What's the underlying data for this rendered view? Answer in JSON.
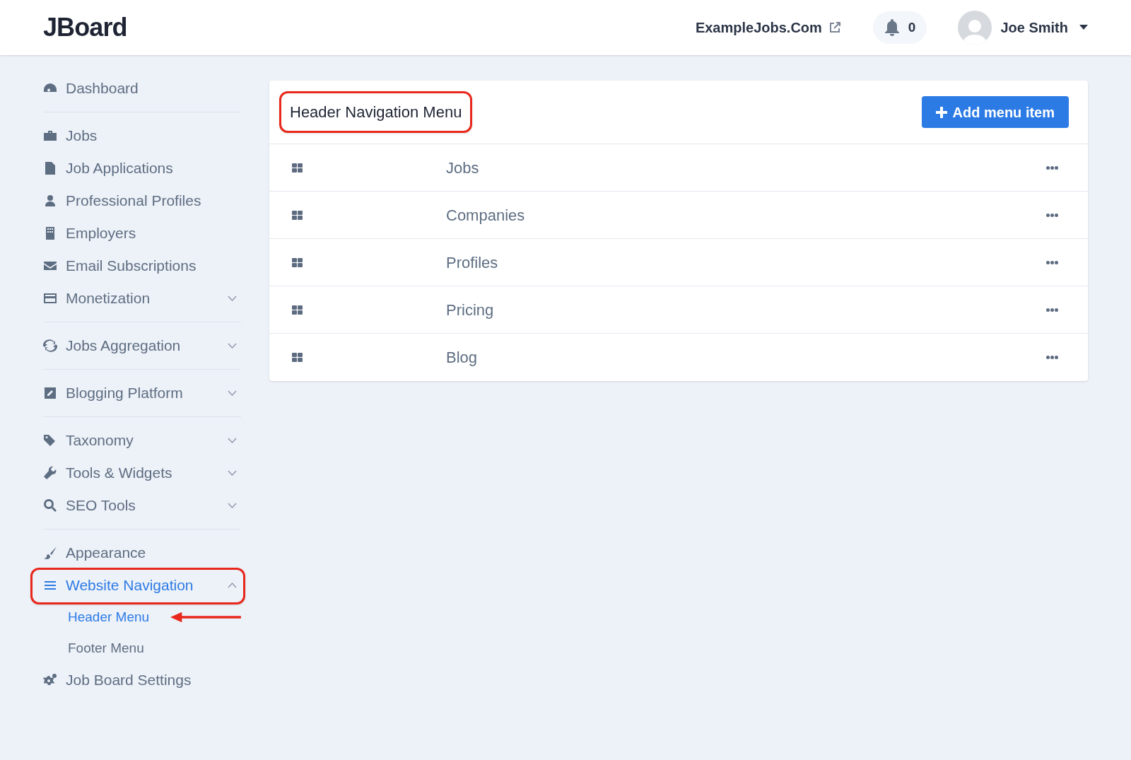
{
  "header": {
    "logo": "JBoard",
    "site_link": "ExampleJobs.Com",
    "notifications": "0",
    "user": "Joe Smith"
  },
  "sidebar": {
    "groups": [
      [
        {
          "label": "Dashboard",
          "selected": false,
          "highlighted": false
        }
      ],
      [
        {
          "label": "Jobs",
          "selected": false,
          "highlighted": false
        },
        {
          "label": "Job Applications",
          "selected": false,
          "highlighted": false
        },
        {
          "label": "Professional Profiles",
          "selected": false,
          "highlighted": false
        },
        {
          "label": "Employers",
          "selected": false,
          "highlighted": false
        },
        {
          "label": "Email Subscriptions",
          "selected": false,
          "highlighted": false
        },
        {
          "label": "Monetization",
          "expanded": false,
          "selected": false,
          "highlighted": false
        }
      ],
      [
        {
          "label": "Jobs Aggregation",
          "expanded": false,
          "selected": false,
          "highlighted": false
        }
      ],
      [
        {
          "label": "Blogging Platform",
          "expanded": false,
          "selected": false,
          "highlighted": false
        }
      ],
      [
        {
          "label": "Taxonomy",
          "expanded": false,
          "selected": false,
          "highlighted": false
        },
        {
          "label": "Tools & Widgets",
          "expanded": false,
          "selected": false,
          "highlighted": false
        },
        {
          "label": "SEO Tools",
          "expanded": false,
          "selected": false,
          "highlighted": false
        }
      ],
      [
        {
          "label": "Appearance",
          "selected": false,
          "highlighted": false
        },
        {
          "label": "Website Navigation",
          "expanded": true,
          "selected": true,
          "highlighted": true,
          "children": [
            {
              "label": "Header Menu",
              "selected": true,
              "pointed": true
            },
            {
              "label": "Footer Menu",
              "selected": false,
              "pointed": false
            }
          ]
        },
        {
          "label": "Job Board Settings",
          "selected": false,
          "highlighted": false
        }
      ]
    ]
  },
  "card": {
    "title": "Header Navigation Menu",
    "title_highlighted": true,
    "add_button": "Add menu item",
    "items": [
      {
        "label": "Jobs"
      },
      {
        "label": "Companies"
      },
      {
        "label": "Profiles"
      },
      {
        "label": "Pricing"
      },
      {
        "label": "Blog"
      }
    ]
  }
}
